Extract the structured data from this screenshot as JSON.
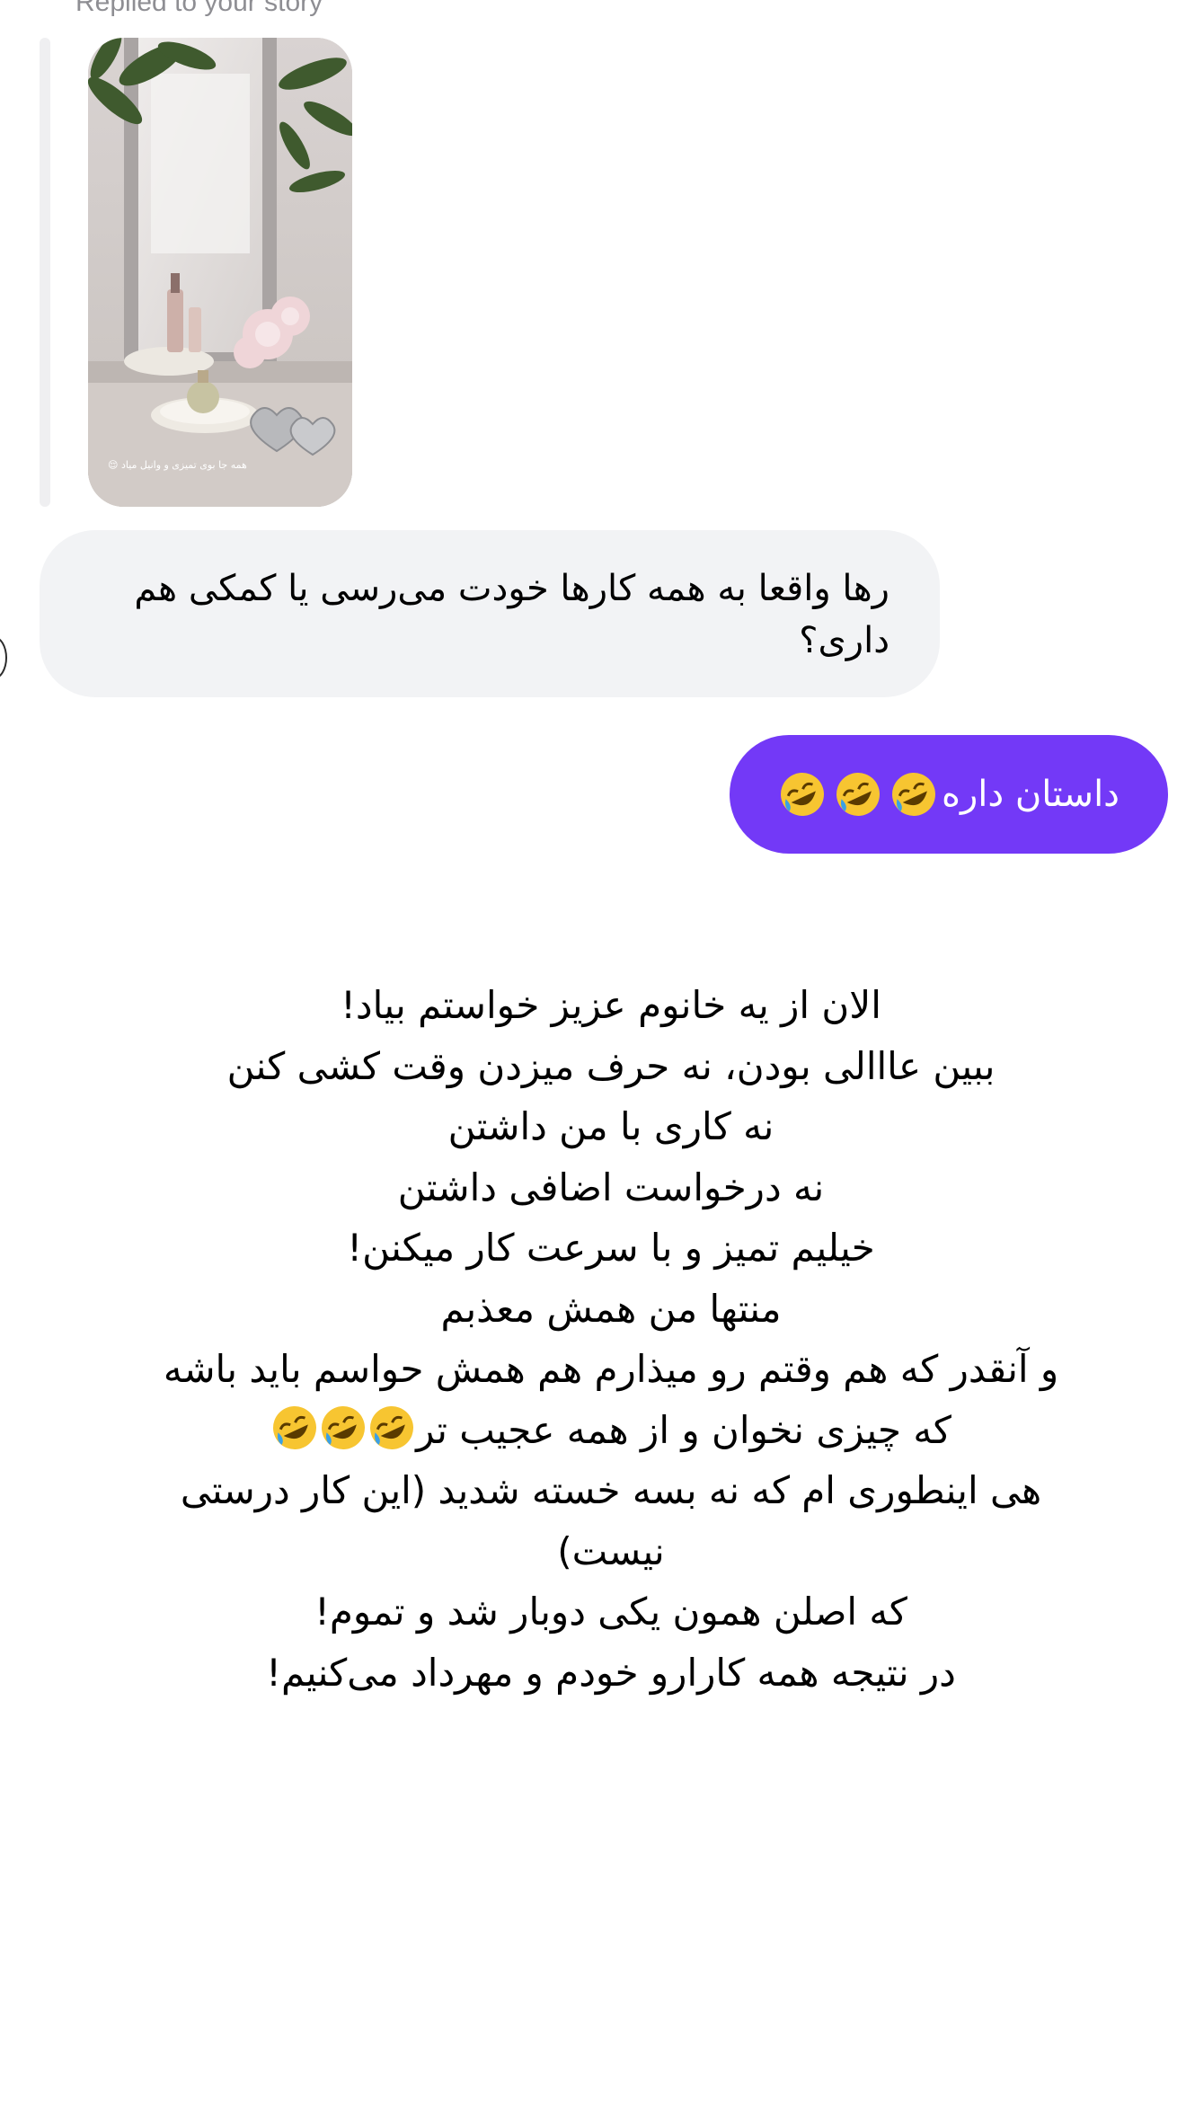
{
  "reply_header": {
    "label": "Replied to your story"
  },
  "story_preview": {
    "caption": "همه جا بوی تمیزی و وانیل میاد 😌",
    "icon": "story-photo-vanity-mirror-flowers"
  },
  "incoming_message": {
    "text": "رها واقعا به همه کارها خودت می‌رسی یا کمکی هم داری؟"
  },
  "outgoing_message": {
    "text": "داستان داره",
    "emoji": "rolling-on-floor-laughing-icon",
    "emoji_count": 3
  },
  "story_text": {
    "lines": [
      "الان از یه خانوم عزیز خواستم بیاد!",
      "ببین عااالی بودن، نه حرف میزدن وقت کشی کنن",
      "نه کاری با من داشتن",
      "نه درخواست اضافی داشتن",
      "خیلیم تمیز و با سرعت کار میکنن!",
      "منتها من همش معذبم",
      "و آنقدر که هم وقتم رو میذارم هم همش حواسم باید باشه",
      "که چیزی نخوان و از همه عجیب تر",
      "هی اینطوری ام که نه بسه خسته شدید (این کار درستی",
      "نیست)",
      "که اصلن همون یکی دوبار شد و تموم!",
      "در نتیجه همه کارارو خودم و مهرداد می‌کنیم!"
    ]
  },
  "colors": {
    "outgoing_bubble": "#7339f7",
    "incoming_bubble": "#f2f3f5",
    "muted_text": "#8e8e93"
  }
}
